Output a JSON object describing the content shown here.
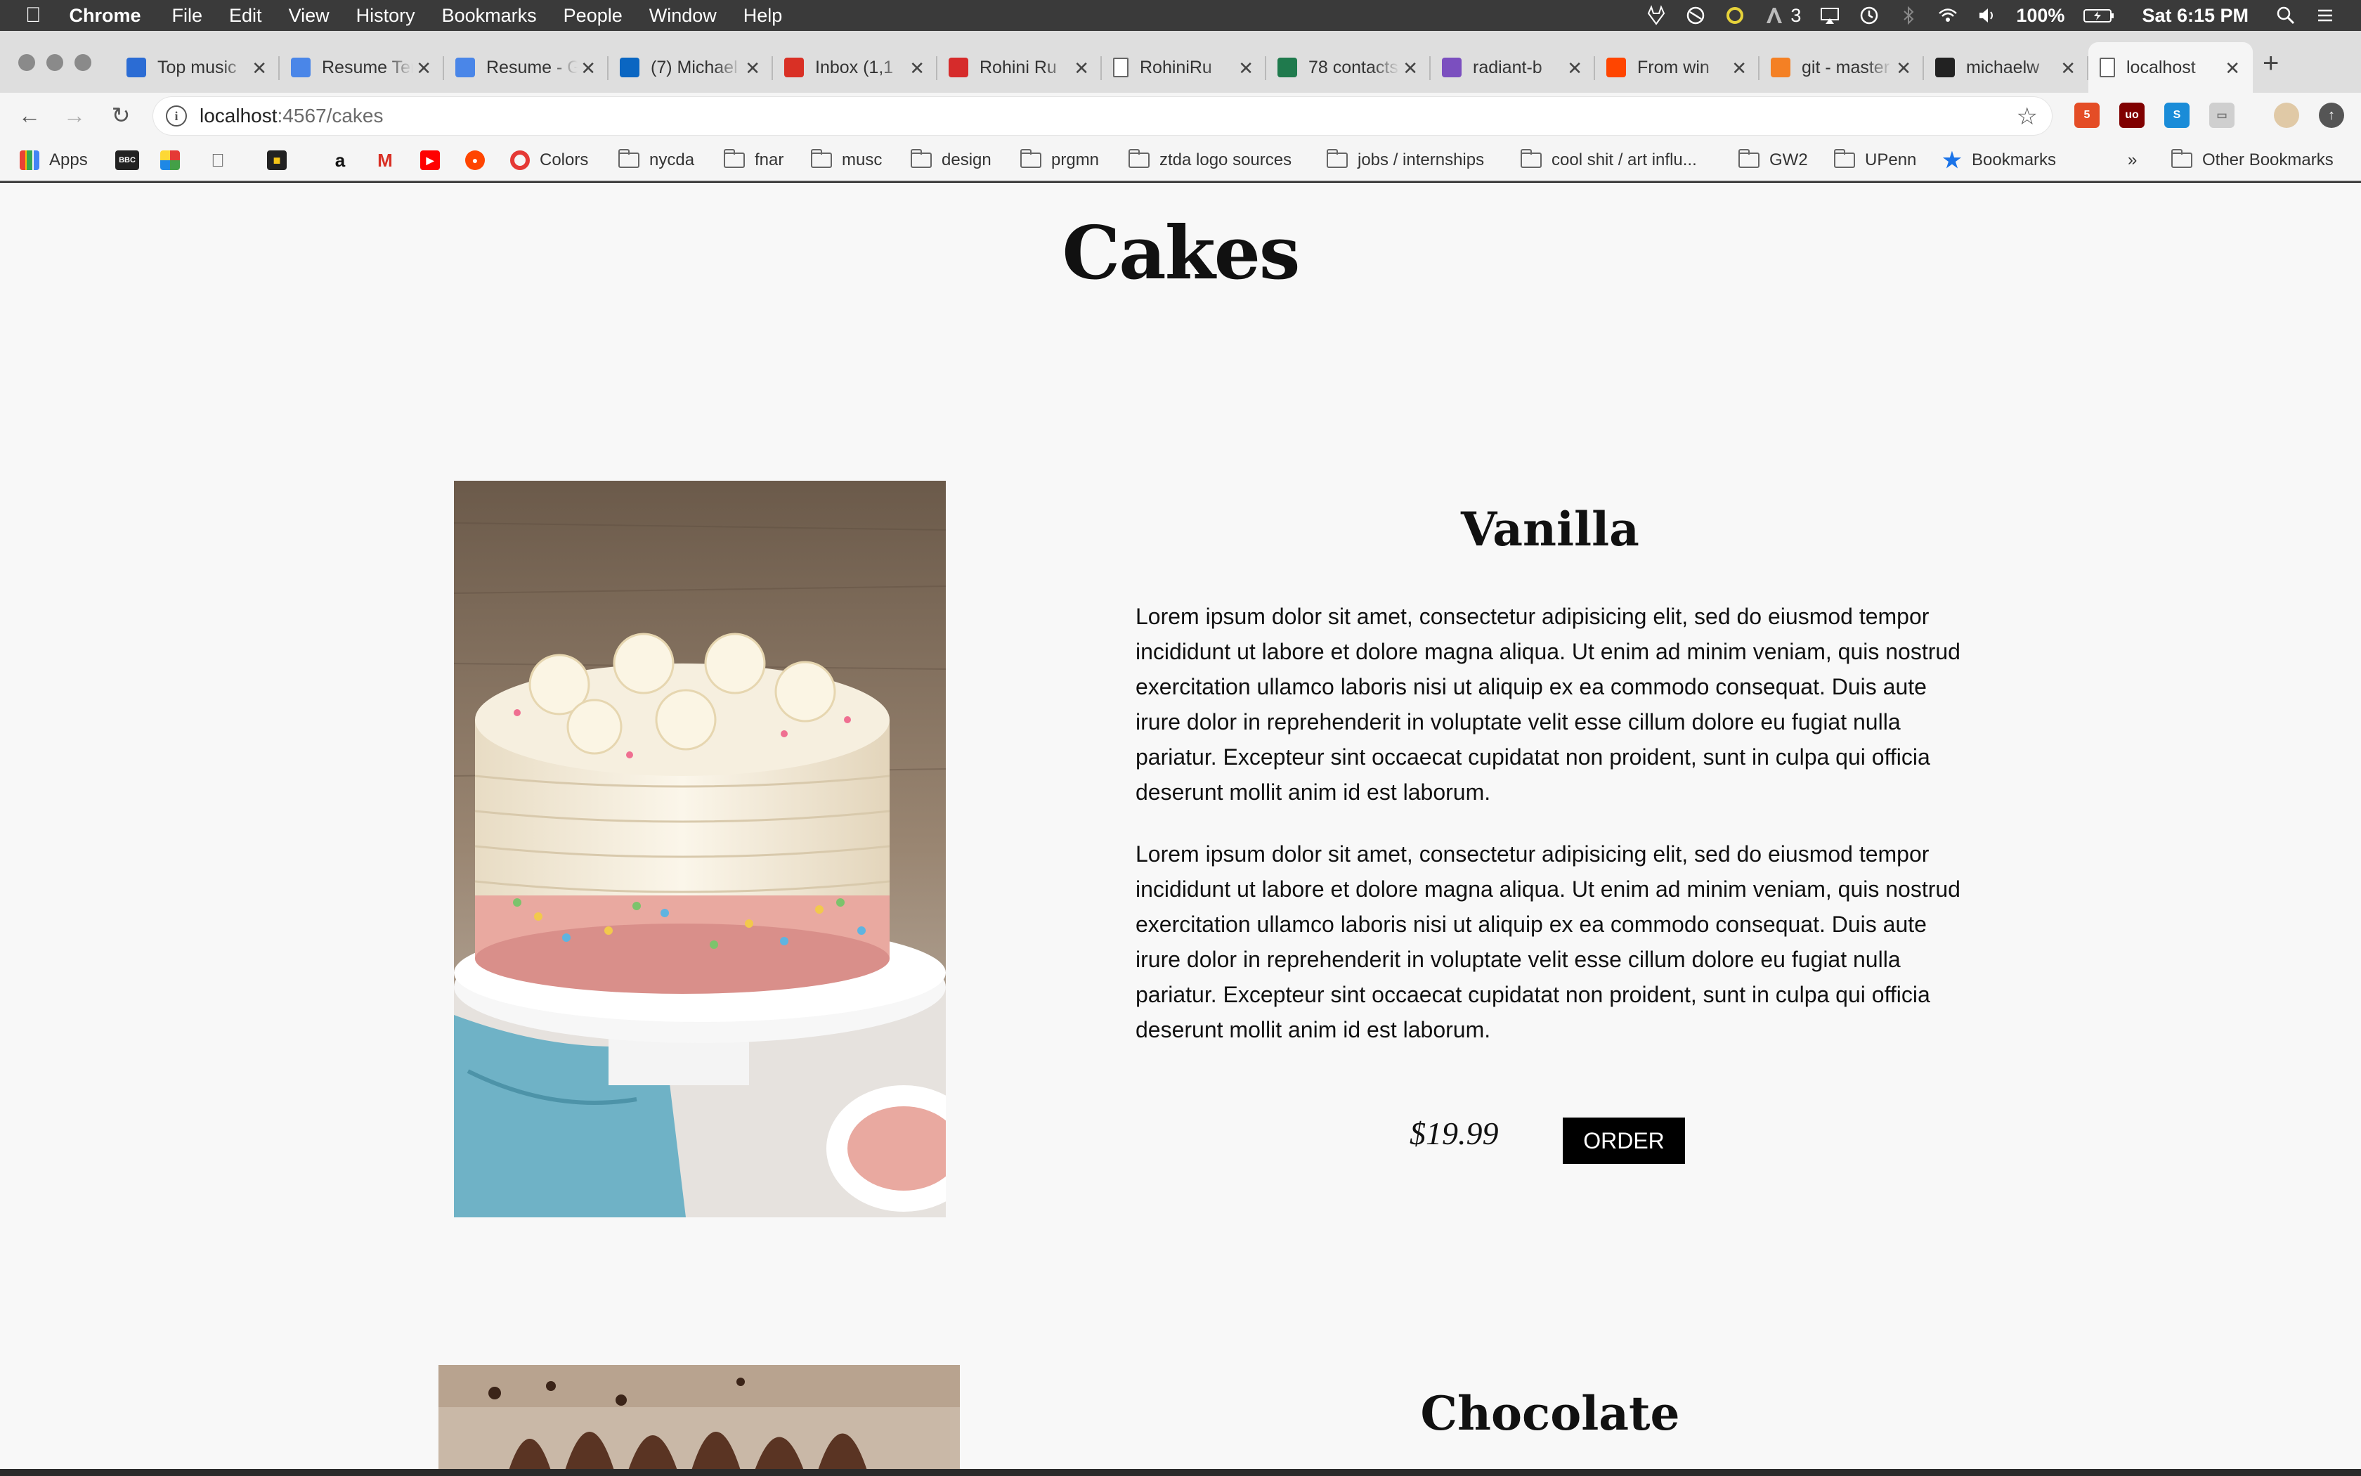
{
  "menubar": {
    "app_name": "Chrome",
    "items": [
      "File",
      "Edit",
      "View",
      "History",
      "Bookmarks",
      "People",
      "Window",
      "Help"
    ],
    "status": {
      "badge_count": "3",
      "battery": "100%",
      "clock": "Sat 6:15 PM"
    }
  },
  "tabs": [
    {
      "title": "Top music",
      "favicon_color": "#2b6cd4"
    },
    {
      "title": "Resume Template",
      "favicon_color": "#4a86e8"
    },
    {
      "title": "Resume - Google",
      "favicon_color": "#4a86e8"
    },
    {
      "title": "(7) Michael",
      "favicon_color": "#0a66c2"
    },
    {
      "title": "Inbox (1,1",
      "favicon_color": "#d93025"
    },
    {
      "title": "Rohini Ru",
      "favicon_color": "#d62b2b"
    },
    {
      "title": "RohiniRu",
      "favicon_color": "#ffffff"
    },
    {
      "title": "78 contacts",
      "favicon_color": "#1f7a4d"
    },
    {
      "title": "radiant-b",
      "favicon_color": "#7b4fbf"
    },
    {
      "title": "From win",
      "favicon_color": "#ff4500"
    },
    {
      "title": "git - master",
      "favicon_color": "#f48024"
    },
    {
      "title": "michaelw",
      "favicon_color": "#222222"
    },
    {
      "title": "localhost",
      "favicon_color": "#ffffff",
      "active": true
    }
  ],
  "omnibox": {
    "host": "localhost",
    "path": ":4567/cakes"
  },
  "bookmarks": {
    "apps_label": "Apps",
    "colors_label": "Colors",
    "folders": [
      "nycda",
      "fnar",
      "musc",
      "design",
      "prgmn",
      "ztda logo sources",
      "jobs / internships",
      "cool shit / art influ...",
      "GW2",
      "UPenn"
    ],
    "bookmarks_label": "Bookmarks",
    "overflow": "»",
    "other_label": "Other Bookmarks"
  },
  "page": {
    "title": "Cakes",
    "cakes": [
      {
        "name": "Vanilla",
        "paragraphs": [
          "Lorem ipsum dolor sit amet, consectetur adipisicing elit, sed do eiusmod tempor incididunt ut labore et dolore magna aliqua. Ut enim ad minim veniam, quis nostrud exercitation ullamco laboris nisi ut aliquip ex ea commodo consequat. Duis aute irure dolor in reprehenderit in voluptate velit esse cillum dolore eu fugiat nulla pariatur. Excepteur sint occaecat cupidatat non proident, sunt in culpa qui officia deserunt mollit anim id est laborum.",
          "Lorem ipsum dolor sit amet, consectetur adipisicing elit, sed do eiusmod tempor incididunt ut labore et dolore magna aliqua. Ut enim ad minim veniam, quis nostrud exercitation ullamco laboris nisi ut aliquip ex ea commodo consequat. Duis aute irure dolor in reprehenderit in voluptate velit esse cillum dolore eu fugiat nulla pariatur. Excepteur sint occaecat cupidatat non proident, sunt in culpa qui officia deserunt mollit anim id est laborum."
        ],
        "price": "$19.99",
        "order_label": "ORDER"
      },
      {
        "name": "Chocolate"
      }
    ]
  }
}
